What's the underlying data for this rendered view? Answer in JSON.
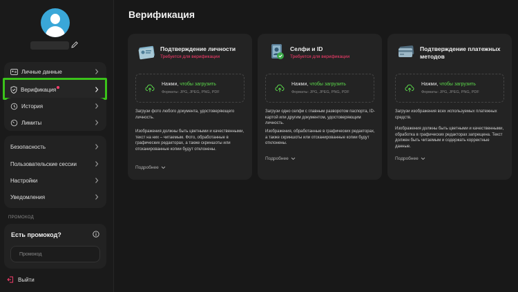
{
  "sidebar": {
    "menu_primary": [
      {
        "label": "Личные данные",
        "icon": "id-card-icon"
      },
      {
        "label": "Верификация",
        "icon": "shield-check-icon"
      },
      {
        "label": "История",
        "icon": "history-icon"
      },
      {
        "label": "Лимиты",
        "icon": "gauge-icon"
      }
    ],
    "menu_secondary": [
      {
        "label": "Безопасность"
      },
      {
        "label": "Пользовательские сессии"
      },
      {
        "label": "Настройки"
      },
      {
        "label": "Уведомления"
      }
    ],
    "promo": {
      "section_label": "ПРОМОКОД",
      "title": "Есть промокод?",
      "placeholder": "Промокод"
    },
    "logout_label": "Выйти"
  },
  "main": {
    "title": "Верификация",
    "cards": [
      {
        "title": "Подтверждение личности",
        "subtitle": "Требуется для верификации",
        "upload_prefix": "Нажми, ",
        "upload_link": "чтобы загрузить",
        "formats": "Форматы: JPG, JPEG, PNG, PDF",
        "desc1": "Загрузи фото любого документа, удостоверяющего личность.",
        "desc2": "Изображения должны быть цветными и качественными, текст на них – читаемым. Фото, обработанные в графических редакторах, а также скриншоты или отсканированные копии будут отклонены.",
        "more": "Подробнее"
      },
      {
        "title": "Селфи и ID",
        "subtitle": "Требуется для верификации",
        "upload_prefix": "Нажми, ",
        "upload_link": "чтобы загрузить",
        "formats": "Форматы: JPG, JPEG, PNG, PDF",
        "desc1": "Загрузи одно селфи с главным разворотом паспорта, ID-картой или другим документом, удостоверяющим личность.",
        "desc2": "Изображения, обработанные в графических редакторах, а также скриншоты или отсканированные копии будут отклонены.",
        "more": "Подробнее"
      },
      {
        "title": "Подтверждение платежных методов",
        "subtitle": "",
        "upload_prefix": "Нажми, ",
        "upload_link": "чтобы загрузить",
        "formats": "Форматы: JPG, JPEG, PNG, PDF",
        "desc1": "Загрузи изображения всех используемых платежных средств.",
        "desc2": "Изображения должны быть цветными и качественными, обработка в графических редакторах запрещена. Текст должен быть читаемым и содержать корректные данные.",
        "more": "Подробнее"
      }
    ]
  },
  "colors": {
    "accent_green": "#5ddc4c",
    "highlight_green": "#3bc21a",
    "alert_red": "#ff3d6e"
  }
}
